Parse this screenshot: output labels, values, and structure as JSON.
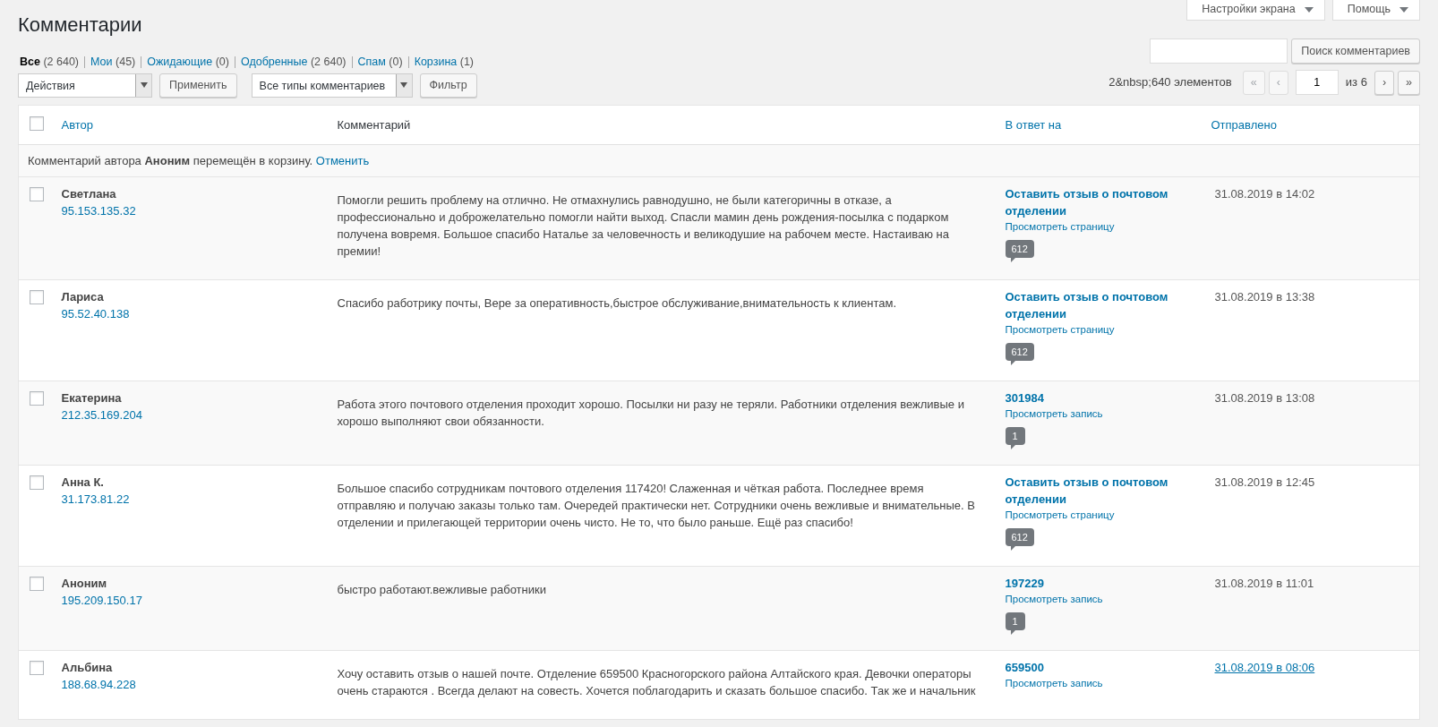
{
  "page_title": "Комментарии",
  "screen_tabs": [
    {
      "label": "Настройки экрана"
    },
    {
      "label": "Помощь"
    }
  ],
  "filters": [
    {
      "label": "Все",
      "count": "(2 640)",
      "selected": true
    },
    {
      "label": "Мои",
      "count": "(45)",
      "selected": false
    },
    {
      "label": "Ожидающие",
      "count": "(0)",
      "selected": false
    },
    {
      "label": "Одобренные",
      "count": "(2 640)",
      "selected": false
    },
    {
      "label": "Спам",
      "count": "(0)",
      "selected": false
    },
    {
      "label": "Корзина",
      "count": "(1)",
      "selected": false
    }
  ],
  "search": {
    "button": "Поиск комментариев"
  },
  "bulk_actions": {
    "select": "Действия",
    "button": "Применить"
  },
  "type_filter": {
    "select": "Все типы комментариев",
    "button": "Фильтр"
  },
  "pagination": {
    "total": "2&nbsp;640 элементов",
    "buttons": [
      {
        "label": "«",
        "disabled": true
      },
      {
        "label": "‹",
        "disabled": true
      }
    ],
    "page": "1",
    "of": "из 6",
    "next_buttons": [
      {
        "label": "›",
        "disabled": false
      },
      {
        "label": "»",
        "disabled": false
      }
    ]
  },
  "table": {
    "select_all": {
      "checked": false
    },
    "columns": [
      {
        "label": "Автор",
        "sortable": true
      },
      {
        "label": "Комментарий",
        "sortable": false
      },
      {
        "label": "В ответ на",
        "sortable": true
      },
      {
        "label": "Отправлено",
        "sortable": true
      }
    ],
    "notice": {
      "text": "Комментарий автора **Аноним** перемещён в корзину.",
      "link": "Отменить"
    },
    "rows": [
      {
        "checked": false,
        "author": "Светлана",
        "ip": "95.153.135.32",
        "comment": "Помогли решить проблему на отлично. Не отмахнулись равнодушно, не были категоричны в отказе, а профессионально и доброжелательно помогли найти выход. Спасли мамин день рождения-посылка с подарком получена вовремя. Большое спасибо Наталье за человечность и великодушие на рабочем месте. Настаиваю на премии!",
        "post": "Оставить отзыв о почтовом отделении",
        "view": "Просмотреть страницу",
        "count": "612",
        "date": "31.08.2019 в 14:02",
        "date_highlighted": false
      },
      {
        "checked": false,
        "author": "Лариса",
        "ip": "95.52.40.138",
        "comment": "Спасибо работрику почты, Вере за оперативность,быстрое обслуживание,внимательность к клиентам.",
        "post": "Оставить отзыв о почтовом отделении",
        "view": "Просмотреть страницу",
        "count": "612",
        "date": "31.08.2019 в 13:38",
        "date_highlighted": false
      },
      {
        "checked": false,
        "author": "Екатерина",
        "ip": "212.35.169.204",
        "comment": "Работа этого почтового отделения проходит хорошо. Посылки ни разу не теряли. Работники отделения вежливые и хорошо выполняют свои обязанности.",
        "post": "301984",
        "view": "Просмотреть запись",
        "count": "1",
        "date": "31.08.2019 в 13:08",
        "date_highlighted": false
      },
      {
        "checked": false,
        "author": "Анна К.",
        "ip": "31.173.81.22",
        "comment": "Большое спасибо сотрудникам почтового отделения 117420! Слаженная и чёткая работа. Последнее время отправляю и получаю заказы только там. Очередей практически нет. Сотрудники очень вежливые и внимательные. В отделении и прилегающей территории очень чисто. Не то, что было раньше. Ещё раз спасибо!",
        "post": "Оставить отзыв о почтовом отделении",
        "view": "Просмотреть страницу",
        "count": "612",
        "date": "31.08.2019 в 12:45",
        "date_highlighted": false
      },
      {
        "checked": false,
        "author": "Аноним",
        "ip": "195.209.150.17",
        "comment": "быстро работают.вежливые работники",
        "post": "197229",
        "view": "Просмотреть запись",
        "count": "1",
        "date": "31.08.2019 в 11:01",
        "date_highlighted": false
      },
      {
        "checked": false,
        "author": "Альбина",
        "ip": "188.68.94.228",
        "comment": "Хочу оставить отзыв о нашей почте. Отделение 659500 Красногорского района Алтайского края. Девочки операторы очень стараются . Всегда делают на совесть. Хочется поблагодарить и сказать большое спасибо. Так же и начальник",
        "post": "659500",
        "view": "Просмотреть запись",
        "date": "31.08.2019 в 08:06",
        "date_highlighted": true
      }
    ]
  }
}
